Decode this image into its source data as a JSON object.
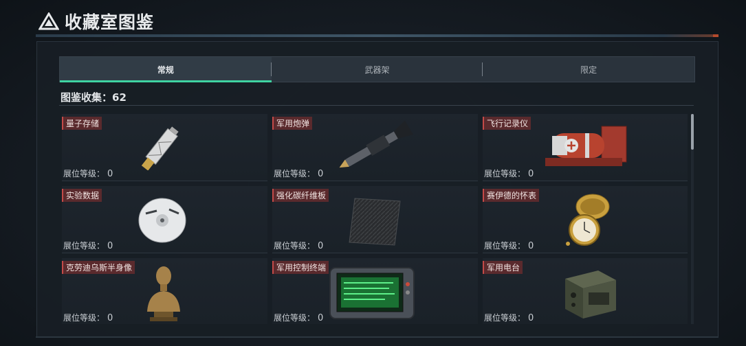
{
  "header": {
    "title": "收藏室图鉴",
    "icon": "warning-triangle-icon"
  },
  "tabs": [
    {
      "label": "常规",
      "active": true
    },
    {
      "label": "武器架",
      "active": false
    },
    {
      "label": "限定",
      "active": false
    }
  ],
  "collection": {
    "label": "图鉴收集：62"
  },
  "level_label": "展位等级：",
  "items": [
    {
      "name": "量子存储",
      "level": "0",
      "icon": "usb-drive-icon"
    },
    {
      "name": "军用炮弹",
      "level": "0",
      "icon": "artillery-shell-icon"
    },
    {
      "name": "飞行记录仪",
      "level": "0",
      "icon": "flight-recorder-icon"
    },
    {
      "name": "实验数据",
      "level": "0",
      "icon": "data-disc-icon"
    },
    {
      "name": "强化碳纤维板",
      "level": "0",
      "icon": "carbon-plate-icon"
    },
    {
      "name": "赛伊德的怀表",
      "level": "0",
      "icon": "pocket-watch-icon"
    },
    {
      "name": "克劳迪乌斯半身像",
      "level": "0",
      "icon": "bust-statue-icon"
    },
    {
      "name": "军用控制终端",
      "level": "0",
      "icon": "control-terminal-icon"
    },
    {
      "name": "军用电台",
      "level": "0",
      "icon": "military-radio-icon"
    }
  ],
  "colors": {
    "accent": "#3fd4a2",
    "name_tag_bg": "#5a2a2d",
    "name_tag_border": "#c44a48"
  }
}
